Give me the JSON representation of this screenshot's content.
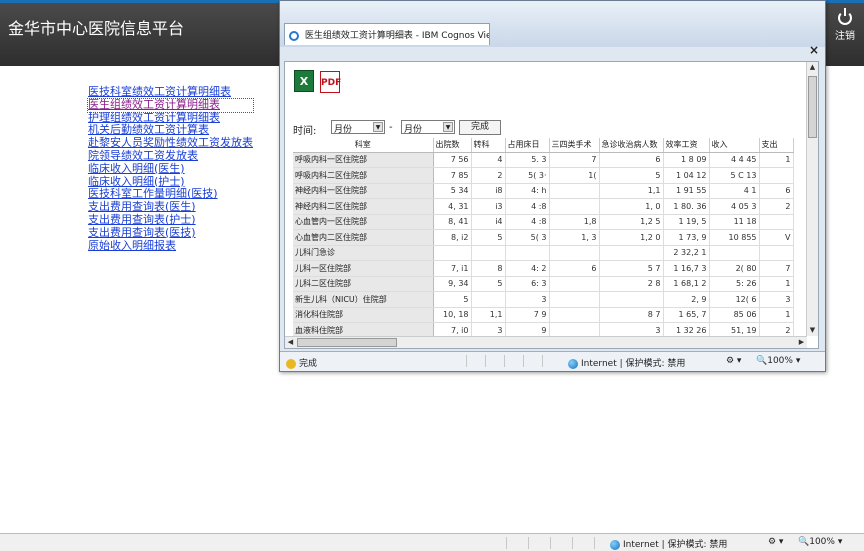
{
  "app": {
    "title": "金华市中心医院信息平台",
    "logout_label": "注销"
  },
  "sidebar": {
    "links": [
      "医技科室绩效工资计算明细表",
      "医生组绩效工资计算明细表",
      "护理组绩效工资计算明细表",
      "机关后勤绩效工资计算表",
      "赴黎安人员奖励性绩效工资发放表",
      "院领导绩效工资发放表",
      "临床收入明细(医生)",
      "临床收入明细(护士)",
      "医技科室工作量明细(医技)",
      "支出费用查询表(医生)",
      "支出费用查询表(护士)",
      "支出费用查询表(医技)",
      "原始收入明细报表"
    ]
  },
  "popup": {
    "tab_title": "医生组绩效工资计算明细表 - IBM Cognos Vie...",
    "close_symbol": "×",
    "export_excel_icon": "excel-icon",
    "export_pdf_icon": "pdf-icon",
    "filter": {
      "label": "时间:",
      "from_value": "月份",
      "to_value": "月份",
      "separator": "-",
      "done_button": "完成"
    },
    "table": {
      "headers": [
        "科室",
        "出院数",
        "转科",
        "占用床日",
        "三四类手术",
        "急诊收治病人数",
        "效率工资",
        "收入",
        "支出"
      ],
      "rows": [
        [
          "呼吸内科一区住院部",
          "7  56",
          "4",
          "5.  3",
          "7",
          "6",
          "1  8   09",
          "4  4    45",
          "1"
        ],
        [
          "呼吸内科二区住院部",
          "7  85",
          "2",
          "5(  3·",
          "1(",
          "5",
          "1   04   12",
          "5  C   13",
          ""
        ],
        [
          "神经内科一区住院部",
          "5  34",
          "i8",
          "4:  h",
          "",
          "1,1",
          "1   91   55",
          "4  1",
          "6"
        ],
        [
          "神经内科二区住院部",
          "4,  31",
          "i3",
          "4  :8",
          "",
          "1,  0",
          "1   80.  36",
          "4  05   3",
          "2"
        ],
        [
          "心血管内一区住院部",
          "8,  41",
          "i4",
          "4  :8",
          "1,8",
          "1,2  5",
          "1   19,  5",
          "11  18",
          ""
        ],
        [
          "心血管内二区住院部",
          "8,  i2",
          "5",
          "5(  3",
          "1,  3",
          "1,2  0",
          "1   73,  9",
          "10  855",
          "V"
        ],
        [
          "儿科门急诊",
          "",
          "",
          "",
          "",
          "",
          "2   32,2   1",
          "",
          ""
        ],
        [
          "儿科一区住院部",
          "7,  i1",
          "8",
          "4:  2",
          "6",
          "5  7",
          "1   16,7   3",
          "2(  80",
          "7"
        ],
        [
          "儿科二区住院部",
          "9,  34",
          "5",
          "6:  3",
          "",
          "2  8",
          "1   68,1   2",
          "5:  26",
          "1"
        ],
        [
          "新生儿科（NICU）住院部",
          "5",
          "",
          "3",
          "",
          "",
          "2,   9",
          "12(  6",
          "3"
        ],
        [
          "消化科住院部",
          "10,  18",
          "1,1",
          "7  9",
          "",
          "8  7",
          "1   65,  7",
          "85  06",
          "1"
        ],
        [
          "血液科住院部",
          "7,  i0",
          "3",
          "9",
          "",
          "3",
          "1   32   26",
          "51,   19",
          "2"
        ]
      ]
    },
    "status": {
      "left_text": "完成",
      "zone_text": "Internet | 保护模式: 禁用",
      "zoom": "100%"
    }
  },
  "window_status": {
    "zone_text": "Internet | 保护模式: 禁用",
    "zoom": "100%"
  }
}
